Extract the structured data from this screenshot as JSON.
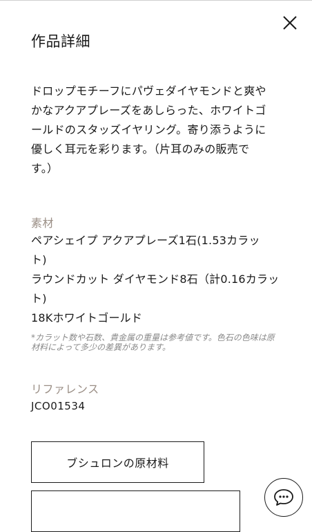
{
  "page": {
    "title": "作品詳細",
    "description": "ドロップモチーフにパヴェダイヤモンドと爽や\nかなアクアプレーズをあしらった、ホワイトゴ\nールドのスタッズイヤリング。寄り添うように\n優しく耳元を彩ります。（片耳のみの販売で\nす。）"
  },
  "materials": {
    "label": "素材",
    "items": [
      "ペアシェイプ アクアプレーズ1石(1.53カラッ\nト)",
      "ラウンドカット ダイヤモンド8石（計0.16カラッ\nト)",
      "18Kホワイトゴールド"
    ],
    "note": "*カラット数や石数、貴金属の重量は参考値です。色石の色味は原材料によって多少の差異があります。"
  },
  "reference": {
    "label": "リファレンス",
    "value": "JCO01534"
  },
  "buttons": {
    "materials_origin": "ブシュロンの原材料"
  },
  "icons": {
    "close": "close-icon",
    "chat": "chat-bubble-icon"
  }
}
